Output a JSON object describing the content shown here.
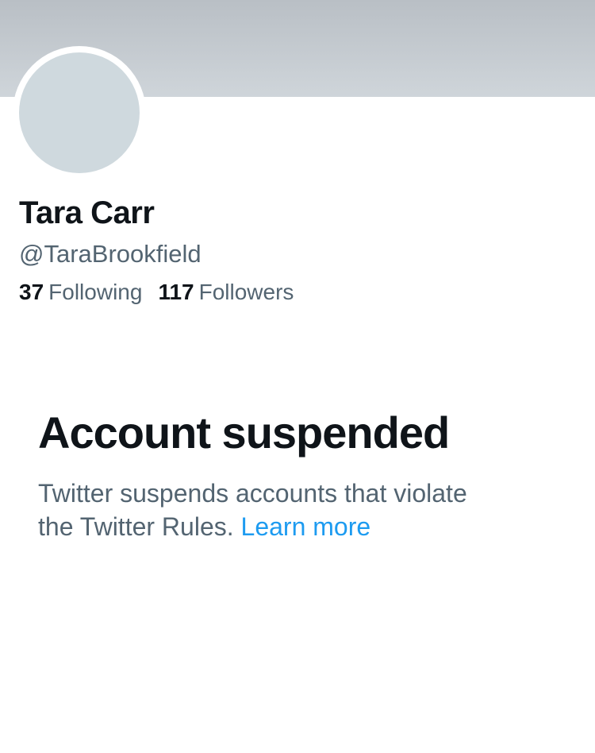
{
  "profile": {
    "display_name": "Tara Carr",
    "handle": "@TaraBrookfield",
    "following_count": "37",
    "following_label": "Following",
    "followers_count": "117",
    "followers_label": "Followers"
  },
  "notice": {
    "title": "Account suspended",
    "body_line1": "Twitter suspends accounts that violate",
    "body_line2": "the Twitter Rules.",
    "link_label": "Learn more"
  },
  "colors": {
    "banner": "#c4cacf",
    "avatar_placeholder": "#cfd9de",
    "text_primary": "#0f1419",
    "text_secondary": "#536471",
    "link": "#1d9bf0"
  }
}
